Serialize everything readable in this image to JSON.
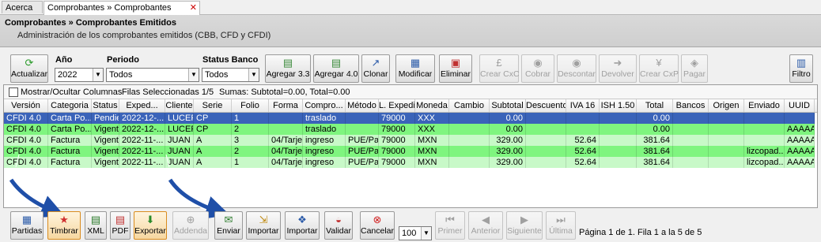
{
  "tabs": [
    {
      "label": "Acerca de"
    },
    {
      "label": "Comprobantes » Comprobantes Emitidos"
    }
  ],
  "header": {
    "title": "Comprobantes » Comprobantes Emitidos",
    "subtitle": "Administración de los comprobantes emitidos (CBB, CFD y CFDI)"
  },
  "toolbar": {
    "actualizar": "Actualizar",
    "anio_label": "Año",
    "anio_value": "2022",
    "periodo_label": "Periodo",
    "periodo_value": "Todos",
    "status_label": "Status Banco",
    "status_value": "Todos",
    "agregar33": "Agregar 3.3",
    "agregar40": "Agregar 4.0",
    "clonar": "Clonar",
    "modificar": "Modificar",
    "eliminar": "Eliminar",
    "crear_cxc": "Crear CxC",
    "cobrar": "Cobrar",
    "descontar": "Descontar",
    "devolver": "Devolver",
    "crear_cxp": "Crear CxP",
    "pagar": "Pagar",
    "filtro": "Filtro"
  },
  "grid_info": {
    "mostrar": "Mostrar/Ocultar Columnas",
    "filas": "Filas Seleccionadas  1/5",
    "sumas": "Sumas:  Subtotal=0.00, Total=0.00"
  },
  "columns": [
    "Versión",
    "Categoria",
    "Status",
    "Exped...",
    "Cliente",
    "Serie",
    "Folio",
    "Forma",
    "Compro...",
    "Método",
    "L. Expedi...",
    "Moneda",
    "Cambio",
    "Subtotal",
    "Descuento",
    "IVA 16",
    "ISH 1.50",
    "Total",
    "Bancos",
    "Origen",
    "Enviado",
    "UUID"
  ],
  "rows": [
    [
      "CFDI 4.0",
      "Carta Po...",
      "Pendiente",
      "2022-12-...",
      "LUCERO...",
      "CP",
      "1",
      "",
      "traslado",
      "",
      "79000",
      "XXX",
      "",
      "0.00",
      "",
      "",
      "",
      "0.00",
      "",
      "",
      "",
      ""
    ],
    [
      "CFDI 4.0",
      "Carta Po...",
      "Vigente",
      "2022-12-...",
      "LUCERO...",
      "CP",
      "2",
      "",
      "traslado",
      "",
      "79000",
      "XXX",
      "",
      "0.00",
      "",
      "",
      "",
      "0.00",
      "",
      "",
      "",
      "AAAAA..."
    ],
    [
      "CFDI 4.0",
      "Factura",
      "Vigente",
      "2022-11-...",
      "JUAN L...",
      "A",
      "3",
      "04/Tarjet...",
      "ingreso",
      "PUE/Pag...",
      "79000",
      "MXN",
      "",
      "329.00",
      "",
      "52.64",
      "",
      "381.64",
      "",
      "",
      "",
      "AAAAA..."
    ],
    [
      "CFDI 4.0",
      "Factura",
      "Vigente",
      "2022-11-...",
      "JUAN L...",
      "A",
      "2",
      "04/Tarjet...",
      "ingreso",
      "PUE/Pag...",
      "79000",
      "MXN",
      "",
      "329.00",
      "",
      "52.64",
      "",
      "381.64",
      "",
      "",
      "lizcopad...",
      "AAAAA..."
    ],
    [
      "CFDI 4.0",
      "Factura",
      "Vigente",
      "2022-11-...",
      "JUAN L...",
      "A",
      "1",
      "04/Tarjet...",
      "ingreso",
      "PUE/Pag...",
      "79000",
      "MXN",
      "",
      "329.00",
      "",
      "52.64",
      "",
      "381.64",
      "",
      "",
      "lizcopad...",
      "AAAAA..."
    ]
  ],
  "bottom": {
    "partidas": "Partidas",
    "timbrar": "Timbrar",
    "xml": "XML",
    "pdf": "PDF",
    "exportar": "Exportar",
    "addenda": "Addenda",
    "enviar": "Enviar",
    "importar1": "Importar",
    "importar2": "Importar",
    "validar": "Validar",
    "cancelar": "Cancelar",
    "page_size": "100",
    "primer": "Primer",
    "anterior": "Anterior",
    "siguiente": "Siguiente",
    "ultima": "Última",
    "pager_text": "Página 1 de 1. Fila 1 a la 5 de 5"
  },
  "colors": {
    "selected_row": "#3a63b9",
    "row_green_strong": "#7ff57f",
    "row_green_light": "#c8f9c8",
    "arrow_blue": "#1f4fa8"
  }
}
